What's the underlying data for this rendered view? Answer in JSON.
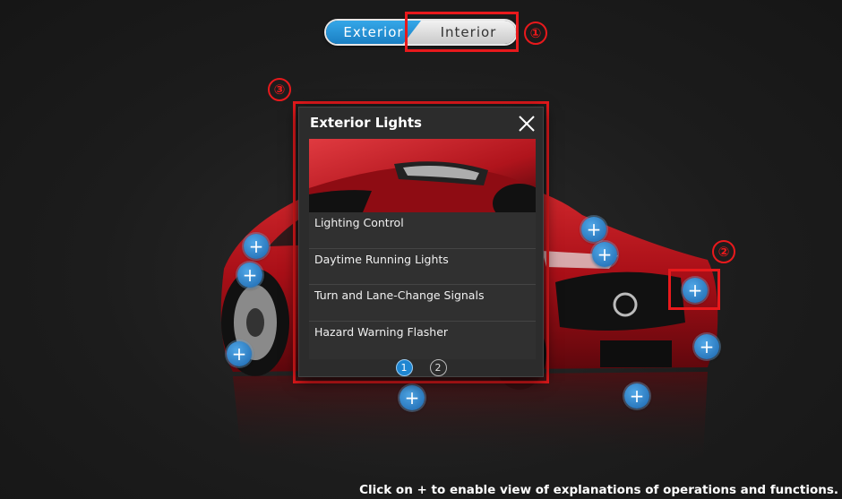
{
  "toggle": {
    "exterior_label": "Exterior",
    "interior_label": "Interior",
    "active": "Exterior"
  },
  "annotations": [
    "①",
    "②",
    "③"
  ],
  "popup": {
    "title": "Exterior Lights",
    "items": [
      {
        "label": "Lighting Control"
      },
      {
        "label": "Daytime Running Lights"
      },
      {
        "label": "Turn and Lane-Change Signals"
      },
      {
        "label": "Hazard Warning Flasher"
      }
    ],
    "pages": [
      "1",
      "2"
    ],
    "active_page": "1"
  },
  "hotspot_symbol": "+",
  "footer": {
    "text": "Click on + to enable view of explanations of operations and functions."
  },
  "colors": {
    "accent": "#1f86d1",
    "annotation": "#e8191c",
    "car": "#b5121b"
  }
}
